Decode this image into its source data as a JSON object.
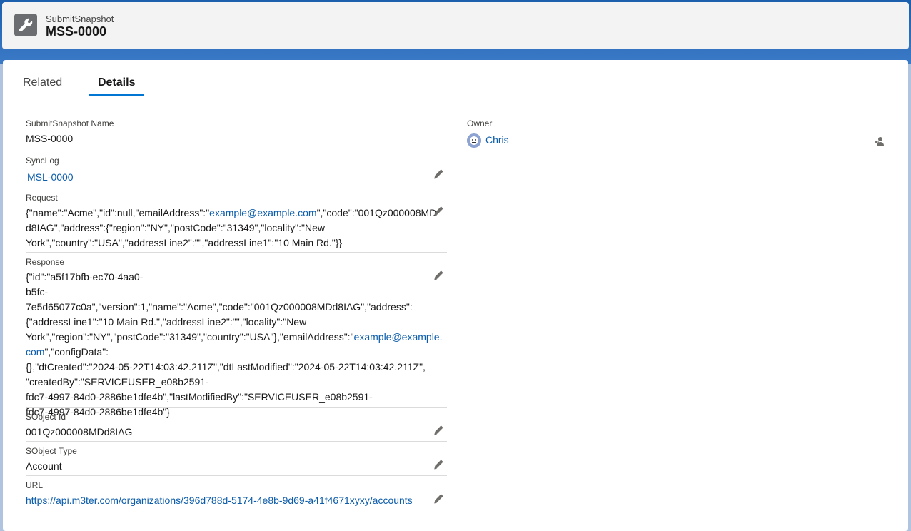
{
  "header": {
    "object_type": "SubmitSnapshot",
    "record_name": "MSS-0000"
  },
  "tabs": [
    {
      "label": "Related",
      "active": false
    },
    {
      "label": "Details",
      "active": true
    }
  ],
  "fields": {
    "name": {
      "label": "SubmitSnapshot Name",
      "value": "MSS-0000"
    },
    "synclog": {
      "label": "SyncLog",
      "value": "MSL-0000"
    },
    "request": {
      "label": "Request",
      "lines": [
        [
          "{\"name\":\"Acme\",\"id\":null,\"emailAddress\":\"",
          "example@example.com",
          "\",\"code\":\"001Qz000008MD"
        ],
        [
          "d8IAG\",\"address\":{\"region\":\"NY\",\"postCode\":\"31349\",\"locality\":\"New"
        ],
        [
          "York\",\"country\":\"USA\",\"addressLine2\":\"\",\"addressLine1\":\"10 Main Rd.\"}}"
        ]
      ]
    },
    "response": {
      "label": "Response",
      "lines": [
        "{\"id\":\"a5f17bfb-ec70-4aa0-",
        "b5fc-7e5d65077c0a\",\"version\":1,\"name\":\"Acme\",\"code\":\"001Qz000008MDd8IAG\",\"address\":",
        "{\"addressLine1\":\"10 Main Rd.\",\"addressLine2\":\"\",\"locality\":\"New",
        "York\",\"region\":\"NY\",\"postCode\":\"31349\",\"country\":\"USA\"},\"emailAddress\":\"",
        "example@example.",
        "com",
        "\",\"configData\":",
        "{},\"dtCreated\":\"2024-05-22T14:03:42.211Z\",\"dtLastModified\":\"2024-05-22T14:03:42.211Z\",",
        "\"createdBy\":\"SERVICEUSER_e08b2591-",
        "fdc7-4997-84d0-2886be1dfe4b\",\"lastModifiedBy\":\"SERVICEUSER_e08b2591-",
        "fdc7-4997-84d0-2886be1dfe4b\"}"
      ]
    },
    "sobject_id": {
      "label": "SObject Id",
      "value": "001Qz000008MDd8IAG"
    },
    "sobject_type": {
      "label": "SObject Type",
      "value": "Account"
    },
    "url": {
      "label": "URL",
      "value": "https://api.m3ter.com/organizations/396d788d-5174-4e8b-9d69-a41f4671xyxy/accounts"
    },
    "owner": {
      "label": "Owner",
      "value": "Chris"
    }
  },
  "icons": {
    "object": "wrench-icon",
    "edit": "pencil-icon",
    "change_owner": "change-owner-icon",
    "avatar": "user-avatar-icon"
  },
  "colors": {
    "link": "#0b5cab",
    "tab_active": "#0176d3",
    "object_icon": "#6b6d70"
  }
}
